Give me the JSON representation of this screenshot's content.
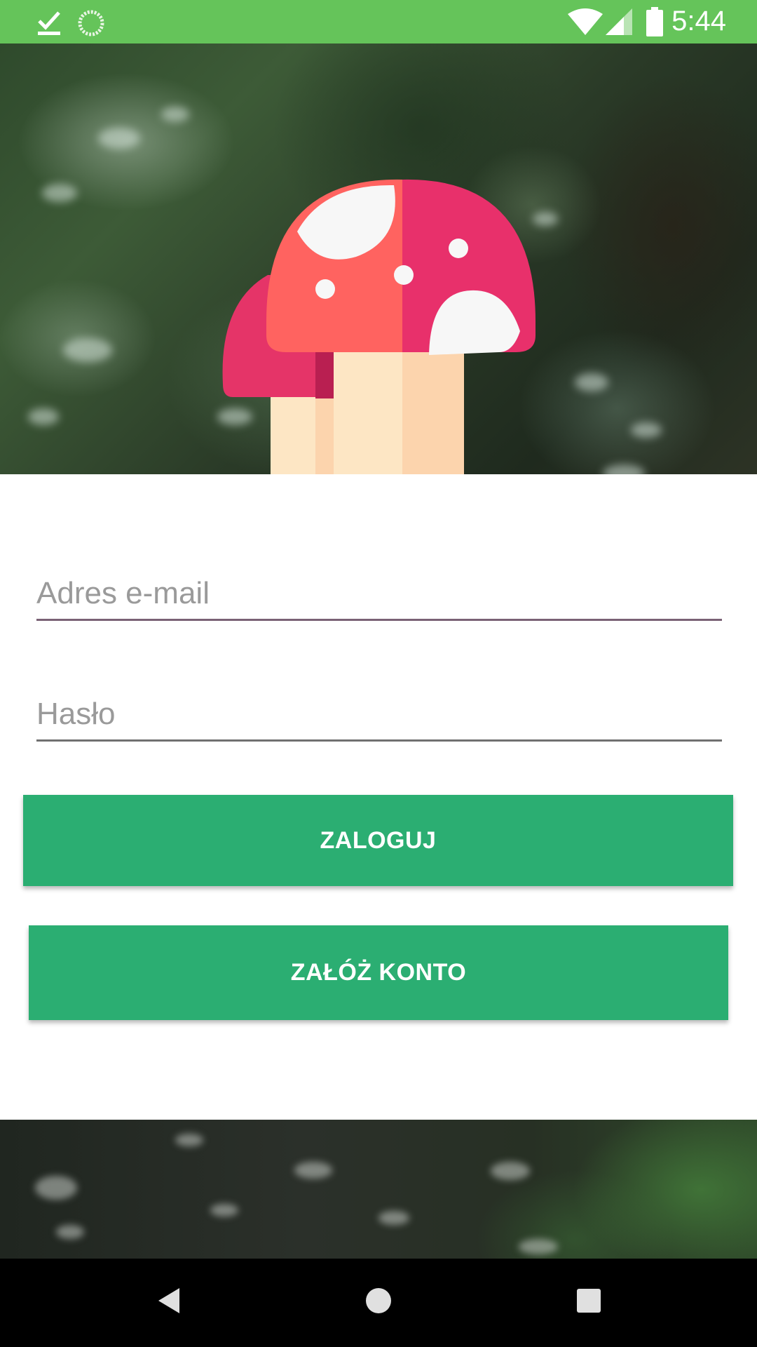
{
  "status_bar": {
    "time": "5:44",
    "icons": [
      "download-done-icon",
      "sync-icon",
      "wifi-icon",
      "cell-signal-icon",
      "battery-icon"
    ],
    "color": "#65c45a"
  },
  "logo": {
    "icon": "mushroom-icon"
  },
  "form": {
    "email_placeholder": "Adres e-mail",
    "email_value": "",
    "password_placeholder": "Hasło",
    "password_value": "",
    "login_label": "ZALOGUJ",
    "register_label": "ZAŁÓŻ KONTO",
    "button_color": "#2bae72"
  },
  "nav_bar": {
    "icons": [
      "back-icon",
      "home-icon",
      "recents-icon"
    ]
  }
}
